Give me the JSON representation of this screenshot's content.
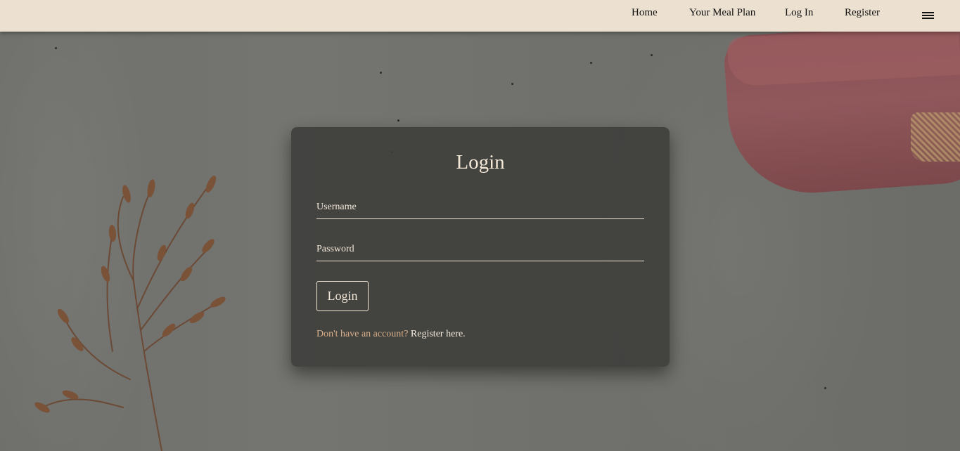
{
  "nav": {
    "links": [
      "Home",
      "Your Meal Plan",
      "Log In",
      "Register"
    ],
    "menu_icon": "hamburger-menu-icon"
  },
  "login": {
    "title": "Login",
    "username_placeholder": "Username",
    "password_placeholder": "Password",
    "submit_label": "Login",
    "register_prompt": "Don't have an account?",
    "register_link": "Register here."
  },
  "colors": {
    "navbar_bg": "#ece0d0",
    "card_bg": "#3c3c3a",
    "accent_text": "#d9b08a",
    "light_text": "#f3e8d8"
  }
}
